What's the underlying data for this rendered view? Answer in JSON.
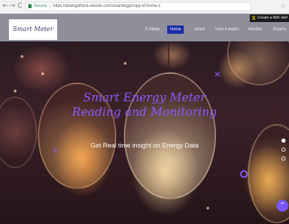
{
  "browser": {
    "back_icon": "←",
    "forward_icon": "→",
    "reload_icon": "C",
    "secure_label": "Secure",
    "url": "https://ahangathora.wixsite.com/smartergy/copy-of-home-1",
    "star_icon": "☆"
  },
  "wix_banner": {
    "x_mark": "X",
    "text": "Create a WiX site!"
  },
  "header": {
    "logo": "Smart Meter",
    "nav": [
      "E-Meter",
      "Home",
      "About",
      "How it works",
      "Monitor",
      "Rooms"
    ],
    "active_index": 1,
    "accent_color": "#1b2ca8"
  },
  "hero": {
    "title": "Smart Energy Meter Reading and Monitoring",
    "subtitle": "Get Real time insight on Energy Data",
    "title_color": "#8a5cff",
    "slide_count": 3,
    "active_slide": 0
  },
  "scroll_button": {
    "icon": "^"
  }
}
